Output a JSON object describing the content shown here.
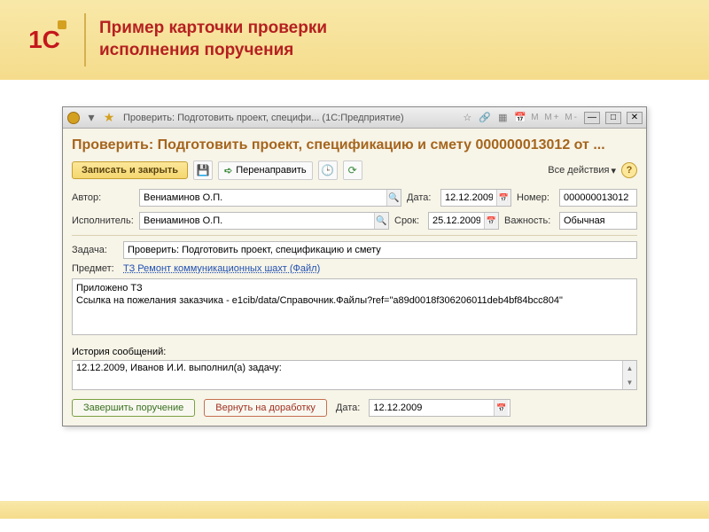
{
  "slide": {
    "logo": "1С",
    "title_line1": "Пример карточки проверки",
    "title_line2": "исполнения поручения"
  },
  "titlebar": {
    "title": "Проверить: Подготовить проект, специфи... (1С:Предприятие)",
    "m_buttons": "M M+ M-"
  },
  "page": {
    "title": "Проверить: Подготовить проект, спецификацию и смету 000000013012 от ..."
  },
  "toolbar": {
    "save_close": "Записать и закрыть",
    "forward": "Перенаправить",
    "all_actions": "Все действия",
    "help": "?"
  },
  "labels": {
    "author": "Автор:",
    "executor": "Исполнитель:",
    "date": "Дата:",
    "deadline": "Срок:",
    "number": "Номер:",
    "importance": "Важность:",
    "task": "Задача:",
    "subject": "Предмет:",
    "history": "История сообщений:",
    "footer_date": "Дата:"
  },
  "values": {
    "author": "Вениаминов О.П.",
    "executor": "Вениаминов О.П.",
    "date": "12.12.2009",
    "deadline": "25.12.2009",
    "number": "000000013012",
    "importance": "Обычная",
    "task": "Проверить: Подготовить проект, спецификацию и смету",
    "subject_link": "ТЗ Ремонт коммуникационных шахт (Файл)",
    "description": "Приложено ТЗ\nСсылка на пожелания заказчика - e1cib/data/Справочник.Файлы?ref=\"a89d0018f306206011deb4bf84bcc804\"",
    "history_entry": "12.12.2009, Иванов И.И. выполнил(а) задачу:",
    "footer_date": "12.12.2009"
  },
  "footer": {
    "complete": "Завершить поручение",
    "rework": "Вернуть на доработку"
  }
}
